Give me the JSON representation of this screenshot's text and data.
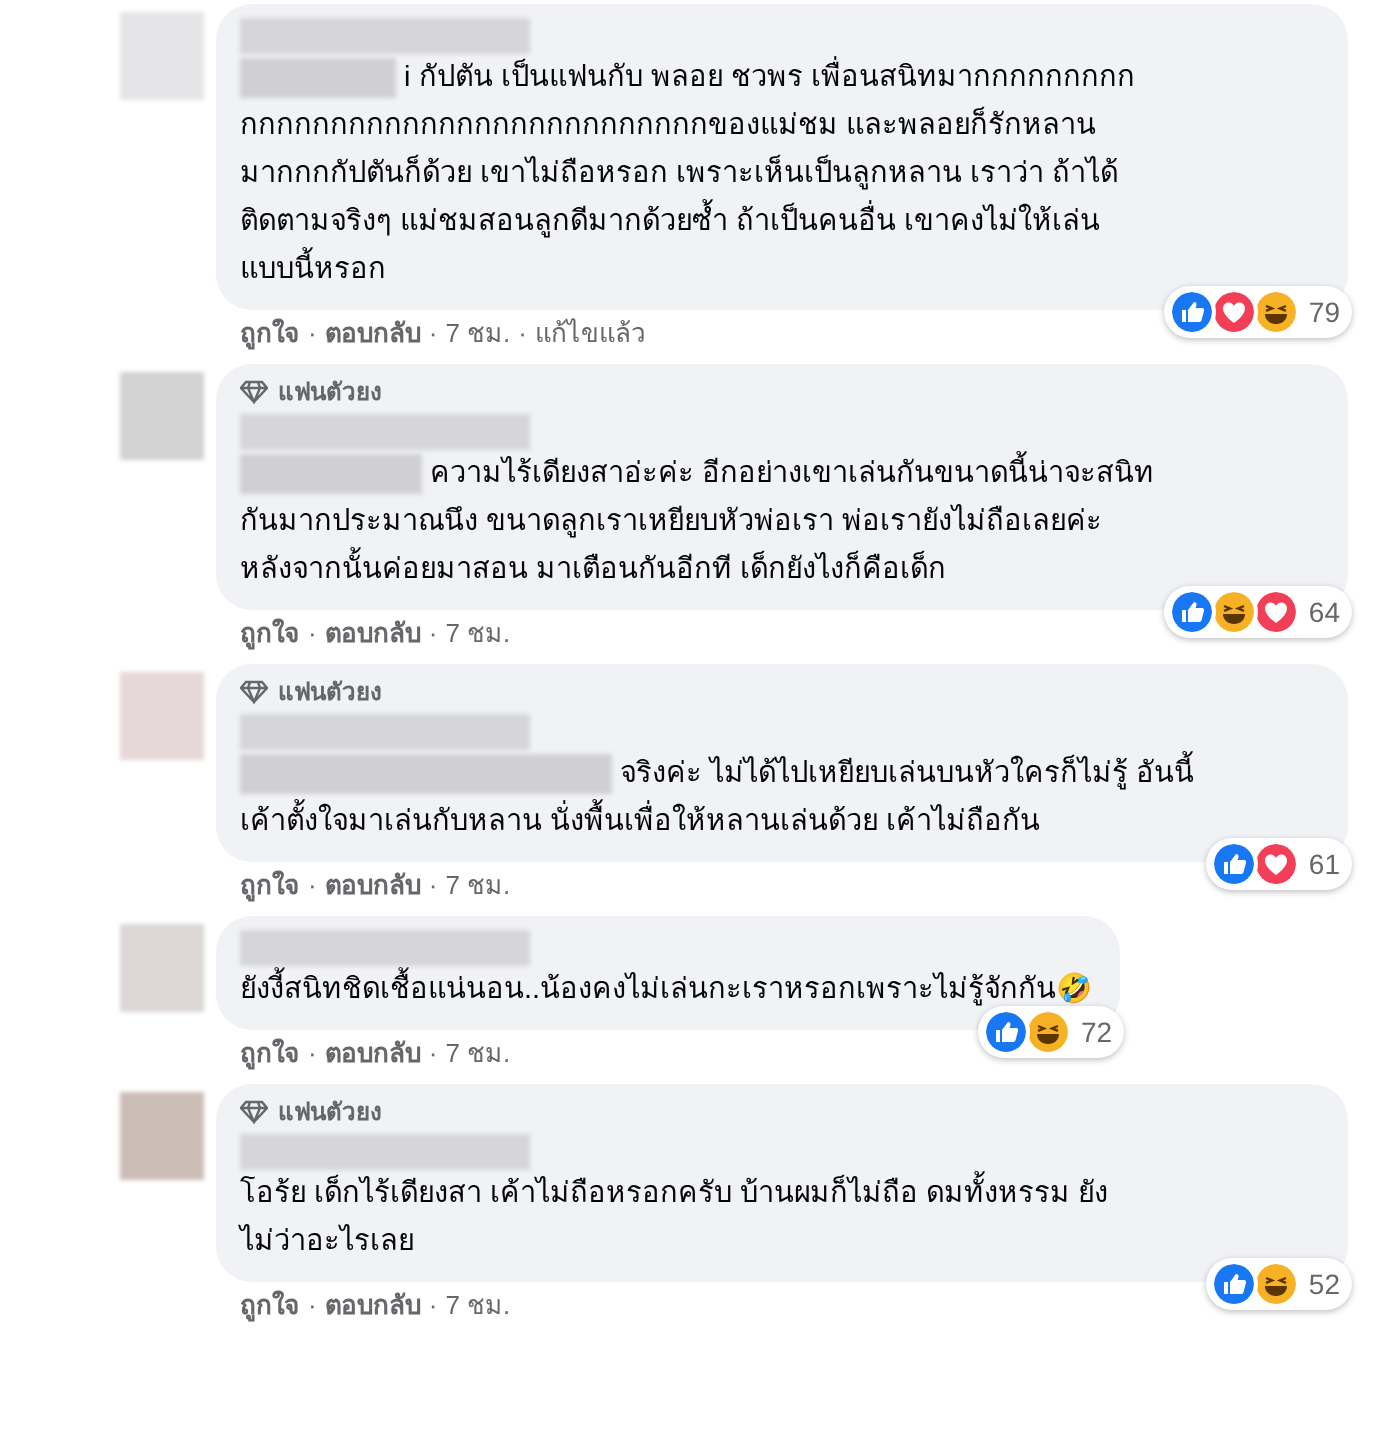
{
  "separator": "·",
  "comments": [
    {
      "text": "i กัปตัน เป็นแฟนกับ พลอย ชวพร เพื่อนสนิทมากกกกกกกกก\nกกกกกกกกกกกกกกกกกกกกกกกกกกของแม่ชม และพลอยก็รักหลาน\nมากกกกัปตันก็ด้วย เขาไม่ถือหรอก เพราะเห็นเป็นลูกหลาน เราว่า ถ้าได้\nติดตามจริงๆ แม่ชมสอนลูกดีมากด้วยซ้ำ ถ้าเป็นคนอื่น เขาคงไม่ให้เล่น\nแบบนี้หรอก",
      "reactions": [
        {
          "kind": "like"
        },
        {
          "kind": "love"
        },
        {
          "kind": "haha"
        }
      ],
      "count": "79",
      "actions": [
        "ถูกใจ",
        "ตอบกลับ",
        "7 ชม.",
        "แก้ไขแล้ว"
      ]
    },
    {
      "badge": "แฟนตัวยง",
      "text": "ความไร้เดียงสาอ่ะค่ะ อีกอย่างเขาเล่นกันขนาดนี้น่าจะสนิท\nกันมากประมาณนึง ขนาดลูกเราเหยียบหัวพ่อเรา พ่อเรายังไม่ถือเลยค่ะ\nหลังจากนั้นค่อยมาสอน มาเตือนกันอีกที เด็กยังไงก็คือเด็ก",
      "reactions": [
        {
          "kind": "like"
        },
        {
          "kind": "haha"
        },
        {
          "kind": "love"
        }
      ],
      "count": "64",
      "actions": [
        "ถูกใจ",
        "ตอบกลับ",
        "7 ชม."
      ]
    },
    {
      "badge": "แฟนตัวยง",
      "text": "จริงค่ะ ไม่ได้ไปเหยียบเล่นบนหัวใครก็ไม่รู้ อันนี้\nเค้าตั้งใจมาเล่นกับหลาน นั่งพื้นเพื่อให้หลานเล่นด้วย เค้าไม่ถือกัน",
      "reactions": [
        {
          "kind": "like"
        },
        {
          "kind": "love"
        }
      ],
      "count": "61",
      "actions": [
        "ถูกใจ",
        "ตอบกลับ",
        "7 ชม."
      ]
    },
    {
      "text": "ยังงี้สนิทชิดเชื้อแน่นอน..น้องคงไม่เล่นกะเราหรอกเพราะไม่รู้จักกัน🤣",
      "reactions": [
        {
          "kind": "like"
        },
        {
          "kind": "haha"
        }
      ],
      "count": "72",
      "actions": [
        "ถูกใจ",
        "ตอบกลับ",
        "7 ชม."
      ]
    },
    {
      "badge": "แฟนตัวยง",
      "text": "โอร้ย เด็กไร้เดียงสา เค้าไม่ถือหรอกครับ บ้านผมก็ไม่ถือ ดมทั้งหรรม ยัง\nไม่ว่าอะไรเลย",
      "reactions": [
        {
          "kind": "like"
        },
        {
          "kind": "haha"
        }
      ],
      "count": "52",
      "actions": [
        "ถูกใจ",
        "ตอบกลับ",
        "7 ชม."
      ]
    }
  ]
}
